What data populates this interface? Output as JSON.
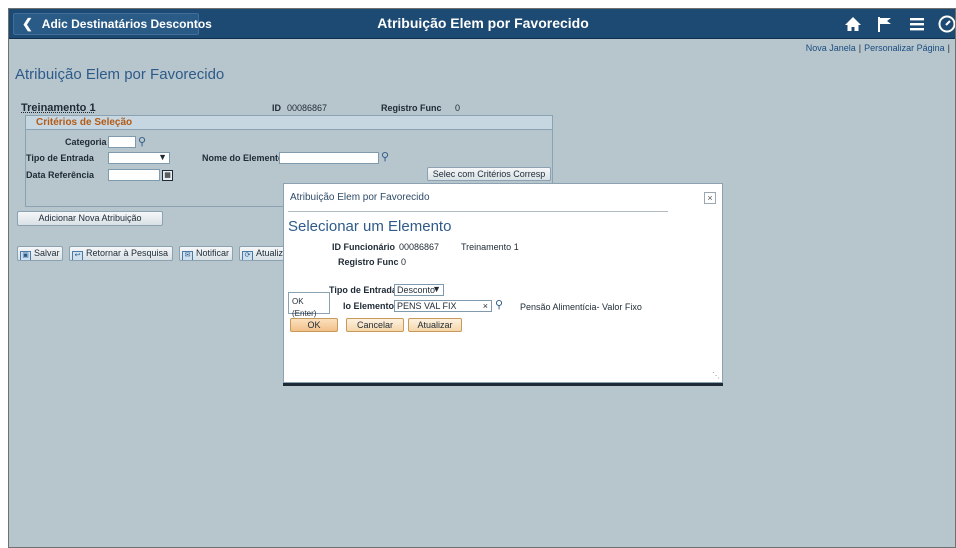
{
  "header": {
    "back_label": "Adic Destinatários Descontos",
    "title": "Atribuição Elem por Favorecido",
    "icons": [
      "home-icon",
      "flag-icon",
      "menu-icon",
      "navbar-icon"
    ]
  },
  "top_links": {
    "new_window": "Nova Janela",
    "personalize": "Personalizar Página",
    "separator": "|"
  },
  "page": {
    "title": "Atribuição Elem por Favorecido",
    "training_name": "Treinamento 1",
    "id_label": "ID",
    "id_value": "00086867",
    "record_label": "Registro Func",
    "record_value": "0"
  },
  "criteria": {
    "title": "Critérios de Seleção",
    "category_label": "Categoria",
    "category_value": "",
    "entry_type_label": "Tipo de Entrada",
    "entry_type_value": "",
    "element_name_label": "Nome do Elemento",
    "element_name_value": "",
    "ref_date_label": "Data Referência",
    "ref_date_value": "",
    "match_button": "Selec com Critérios Corresp"
  },
  "actions": {
    "add_new": "Adicionar Nova Atribuição"
  },
  "toolbar": {
    "save": "Salvar",
    "return_search": "Retornar à Pesquisa",
    "notify": "Notificar",
    "update": "Atualiza"
  },
  "modal": {
    "title": "Atribuição Elem por Favorecido",
    "heading": "Selecionar um Elemento",
    "employee_id_label": "ID Funcionário",
    "employee_id_value": "00086867",
    "employee_name": "Treinamento 1",
    "record_label": "Registro Func",
    "record_value": "0",
    "entry_type_label": "Tipo de Entrada",
    "entry_type_value": "Desconto",
    "element_name_label": "Nome do Elemento",
    "element_name_visible": "lo Elemento",
    "element_name_value": "PENS VAL FIX",
    "element_description": "Pensão Alimentícia- Valor Fixo",
    "ok_button": "OK",
    "cancel_button": "Cancelar",
    "refresh_button": "Atualizar",
    "tooltip": "OK (Enter)"
  },
  "colors": {
    "header_bg": "#1d4a72",
    "page_bg": "#b7c5cc",
    "accent_title": "#2e5b8a",
    "section_title": "#b45a14",
    "primary_button": "#f6c994"
  }
}
